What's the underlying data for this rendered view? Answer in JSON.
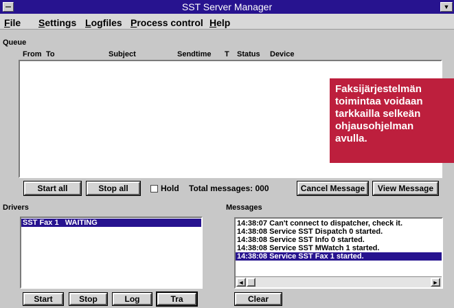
{
  "window": {
    "title": "SST Server Manager"
  },
  "menu": [
    "File",
    "Settings",
    "Logfiles",
    "Process control",
    "Help"
  ],
  "queue": {
    "label": "Queue",
    "columns": [
      "From",
      "To",
      "Subject",
      "Sendtime",
      "T",
      "Status",
      "Device"
    ],
    "buttons": {
      "start_all": "Start all",
      "stop_all": "Stop all",
      "cancel": "Cancel Message",
      "view": "View Message"
    },
    "hold_label": "Hold",
    "total_messages": "Total messages: 000"
  },
  "overlay": {
    "lines": [
      "Faksijärjestelmän",
      "toimintaa voidaan",
      "tarkkailla selkeän",
      "ohjausohjelman",
      "avulla."
    ],
    "color": "#bd1f3d"
  },
  "drivers": {
    "label": "Drivers",
    "items": [
      {
        "name": "SST Fax 1",
        "status": "WAITING"
      }
    ],
    "buttons": {
      "start": "Start",
      "stop": "Stop",
      "log": "Log",
      "tra": "Tra"
    }
  },
  "messages": {
    "label": "Messages",
    "items": [
      "14:38:07 Can't connect to dispatcher, check it.",
      "14:38:08 Service SST Dispatch 0 started.",
      "14:38:08 Service SST Info 0 started.",
      "14:38:08 Service SST MWatch 1 started.",
      "14:38:08 Service SST Fax 1 started."
    ],
    "clear_label": "Clear"
  },
  "colors": {
    "titlebar": "#27138f",
    "selection": "#27138f",
    "window_bg": "#c8c8c8"
  }
}
